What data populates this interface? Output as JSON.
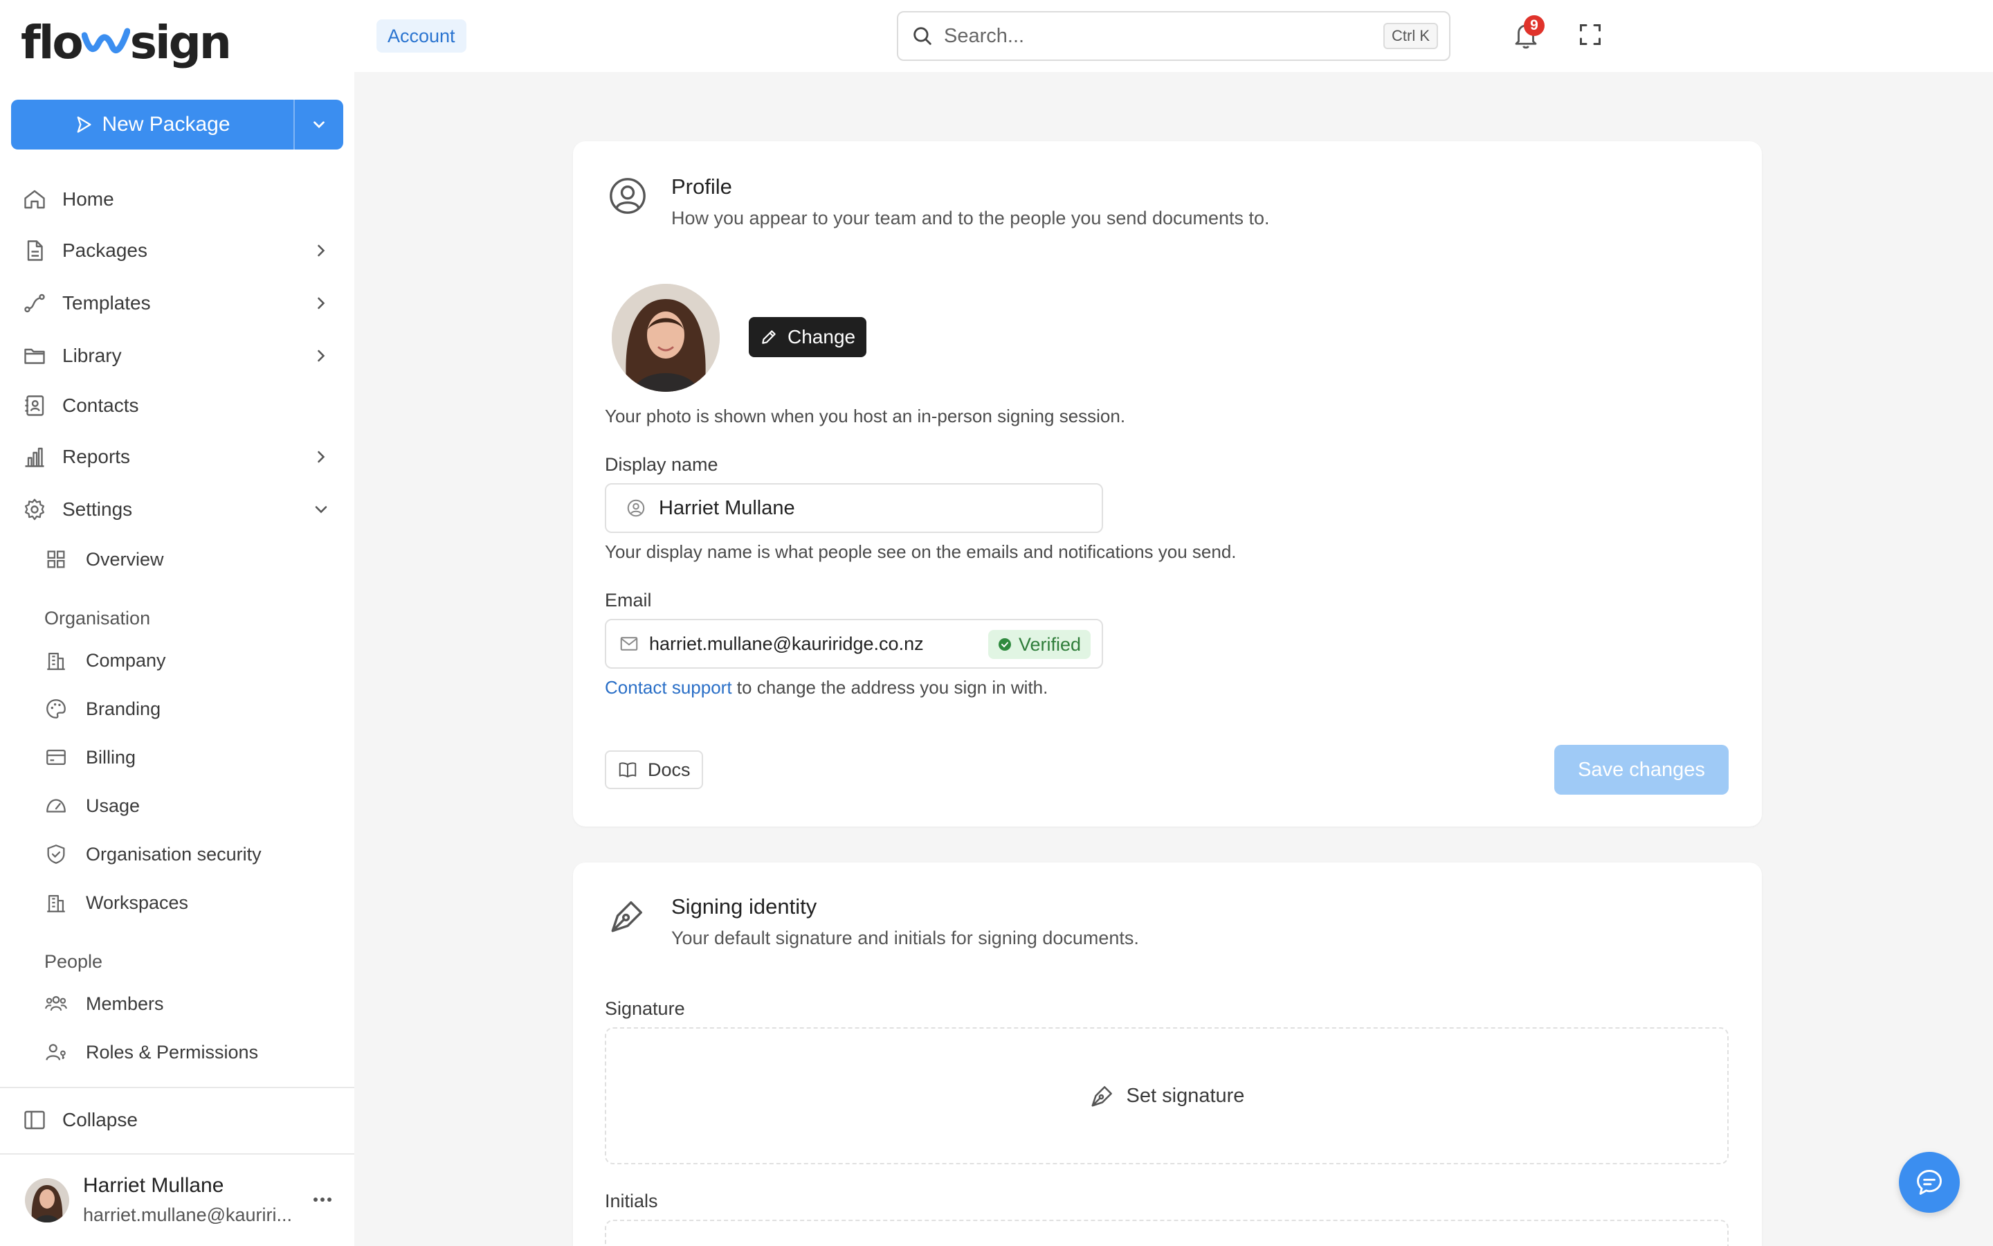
{
  "brand": {
    "name_prefix": "flo",
    "name_suffix": "sign"
  },
  "sidebar": {
    "new_package_label": "New Package",
    "nav": [
      {
        "label": "Home",
        "icon": "home-icon"
      },
      {
        "label": "Packages",
        "icon": "document-icon"
      },
      {
        "label": "Templates",
        "icon": "route-icon"
      },
      {
        "label": "Library",
        "icon": "folder-icon"
      },
      {
        "label": "Contacts",
        "icon": "contacts-icon"
      },
      {
        "label": "Reports",
        "icon": "bar-chart-icon"
      },
      {
        "label": "Settings",
        "icon": "gear-icon"
      }
    ],
    "settings_overview": "Overview",
    "organisation_label": "Organisation",
    "organisation_items": [
      {
        "label": "Company",
        "icon": "building-icon"
      },
      {
        "label": "Branding",
        "icon": "palette-icon"
      },
      {
        "label": "Billing",
        "icon": "credit-card-icon"
      },
      {
        "label": "Usage",
        "icon": "gauge-icon"
      },
      {
        "label": "Organisation security",
        "icon": "shield-icon"
      },
      {
        "label": "Workspaces",
        "icon": "building-icon"
      }
    ],
    "people_label": "People",
    "people_items": [
      {
        "label": "Members",
        "icon": "users-icon"
      },
      {
        "label": "Roles & Permissions",
        "icon": "user-key-icon"
      }
    ],
    "collapse_label": "Collapse",
    "user": {
      "name": "Harriet Mullane",
      "email": "harriet.mullane@kauriri..."
    }
  },
  "topbar": {
    "breadcrumb": "Account",
    "search_placeholder": "Search...",
    "search_shortcut": "Ctrl K",
    "notification_count": "9"
  },
  "profile": {
    "title": "Profile",
    "description": "How you appear to your team and to the people you send documents to.",
    "change_label": "Change",
    "photo_help": "Your photo is shown when you host an in-person signing session.",
    "display_name_label": "Display name",
    "display_name_value": "Harriet Mullane",
    "display_name_help": "Your display name is what people see on the emails and notifications you send.",
    "email_label": "Email",
    "email_value": "harriet.mullane@kauriridge.co.nz",
    "verified_label": "Verified",
    "contact_support_link": "Contact support",
    "contact_support_rest": " to change the address you sign in with.",
    "docs_label": "Docs",
    "save_label": "Save changes"
  },
  "signing_identity": {
    "title": "Signing identity",
    "description": "Your default signature and initials for signing documents.",
    "signature_label": "Signature",
    "set_signature_label": "Set signature",
    "initials_label": "Initials"
  },
  "colors": {
    "accent": "#3b8ef0",
    "save_disabled": "#9fcaf6",
    "verified_bg": "#e1f5e3",
    "verified_text": "#2f7d3a",
    "badge": "#e0332b"
  }
}
